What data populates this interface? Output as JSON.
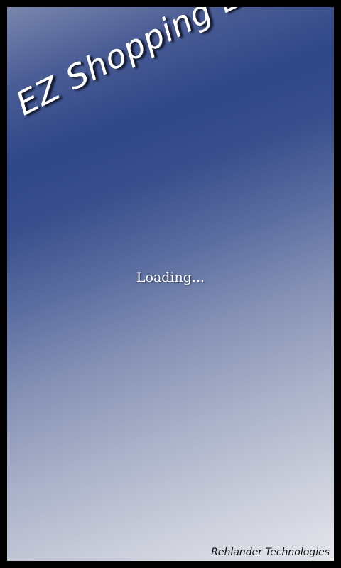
{
  "app": {
    "title": "EZ Shopping List",
    "status": "Loading...",
    "company": "Rehlander Technologies"
  },
  "colors": {
    "frame": "#000000",
    "gradient_top": "#7a86ad",
    "gradient_mid": "#2e4788",
    "gradient_bottom": "#e4e6ec",
    "text": "#ffffff"
  }
}
